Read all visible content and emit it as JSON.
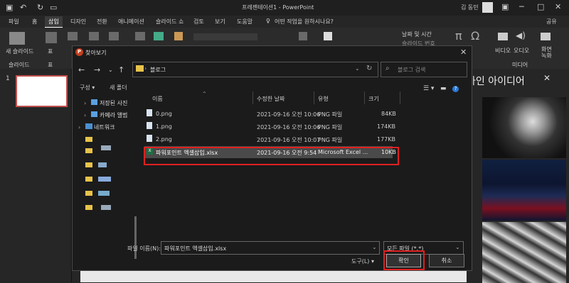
{
  "app": {
    "title": "프레젠테이션1 - PowerPoint",
    "user_name": "김 동민"
  },
  "tabs": [
    "파일",
    "홈",
    "삽입",
    "디자인",
    "전환",
    "애니메이션",
    "슬라이드 쇼",
    "검토",
    "보기",
    "도움말"
  ],
  "active_tab": "삽입",
  "tell_me": "어떤 작업을 원하시나요?",
  "share": "공유",
  "ribbon": {
    "new_slide": "새 슬라이드",
    "slides_group": "슬라이드",
    "table": "표",
    "table_group": "표",
    "date_time": "날짜 및 시간",
    "slide_number": "슬라이드 번호",
    "video": "비디오",
    "audio": "오디오",
    "screen_record": "화면\n녹화",
    "media_group": "미디어"
  },
  "slide_pane": {
    "slide_number": "1"
  },
  "design_pane": {
    "title": "자인 아이디어"
  },
  "dialog": {
    "title": "찾아보기",
    "breadcrumb": "블로그",
    "search_placeholder": "블로그 검색",
    "organize": "구성 ▾",
    "new_folder": "새 폴더",
    "tree": [
      {
        "label": "저장된 사진"
      },
      {
        "label": "카메라 앨범"
      },
      {
        "label": "네트워크"
      }
    ],
    "columns": {
      "name": "이름",
      "modified": "수정한 날짜",
      "type": "유형",
      "size": "크기"
    },
    "files": [
      {
        "name": "0.png",
        "modified": "2021-09-16 오전 10:06",
        "type": "PNG 파일",
        "size": "84KB"
      },
      {
        "name": "1.png",
        "modified": "2021-09-16 오전 10:06",
        "type": "PNG 파일",
        "size": "174KB"
      },
      {
        "name": "2.png",
        "modified": "2021-09-16 오전 10:07",
        "type": "PNG 파일",
        "size": "177KB"
      },
      {
        "name": "파워포인트 엑셀삽입.xlsx",
        "modified": "2021-09-16 오전 9:54",
        "type": "Microsoft Excel ...",
        "size": "10KB"
      }
    ],
    "filename_label": "파일 이름(N):",
    "filename_value": "파워포인트 엑셀삽입.xlsx",
    "filter_value": "모든 파일 (*.*)",
    "tools": "도구(L)",
    "ok": "확인",
    "cancel": "취소"
  }
}
